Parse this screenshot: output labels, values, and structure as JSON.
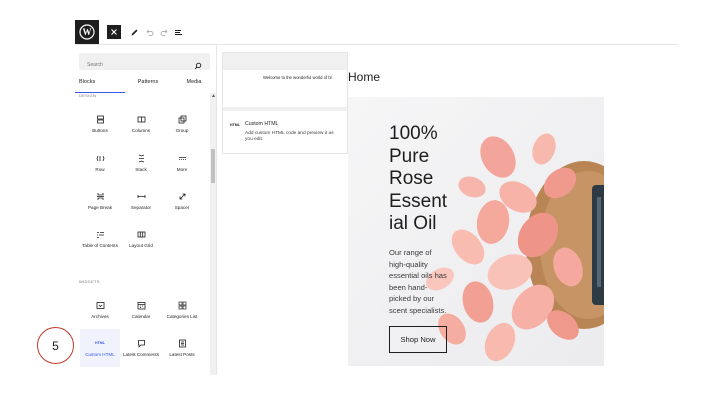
{
  "toolbar": {
    "logo_icon": "wordpress-icon",
    "close_icon": "close-icon",
    "tools_icon": "pencil-icon",
    "undo_icon": "undo-icon",
    "redo_icon": "redo-icon",
    "outline_icon": "list-view-icon"
  },
  "inserter": {
    "search_placeholder": "Search",
    "tabs": [
      "Blocks",
      "Patterns",
      "Media"
    ],
    "active_tab": "Blocks",
    "sections": {
      "design": "DESIGN",
      "widgets": "WIDGETS"
    },
    "design_blocks": [
      {
        "label": "Buttons",
        "icon": "buttons-icon"
      },
      {
        "label": "Columns",
        "icon": "columns-icon"
      },
      {
        "label": "Group",
        "icon": "group-icon"
      },
      {
        "label": "Row",
        "icon": "row-icon"
      },
      {
        "label": "Stack",
        "icon": "stack-icon"
      },
      {
        "label": "More",
        "icon": "more-icon"
      },
      {
        "label": "Page Break",
        "icon": "page-break-icon"
      },
      {
        "label": "Separator",
        "icon": "separator-icon"
      },
      {
        "label": "Spacer",
        "icon": "spacer-icon"
      },
      {
        "label": "Table of Contents",
        "icon": "table-of-contents-icon"
      },
      {
        "label": "Layout Grid",
        "icon": "layout-grid-icon"
      }
    ],
    "widget_blocks": [
      {
        "label": "Archives",
        "icon": "archives-icon"
      },
      {
        "label": "Calendar",
        "icon": "calendar-icon"
      },
      {
        "label": "Categories List",
        "icon": "categories-icon"
      },
      {
        "label": "Custom HTML",
        "icon": "html-icon",
        "badge": "HTML"
      },
      {
        "label": "Latest Comments",
        "icon": "comments-icon"
      },
      {
        "label": "Latest Posts",
        "icon": "latest-posts-icon"
      }
    ]
  },
  "preview": {
    "sample_text": "Welcome to the wonderful world of bl",
    "badge": "HTML",
    "title": "Custom HTML",
    "description": "Add custom HTML code and preview it as you edit."
  },
  "canvas": {
    "page_title": "Home",
    "hero_heading": "100% Pure Rose Essent ial Oil",
    "hero_heading_lines": [
      "100%",
      "Pure",
      "Rose",
      "Essent",
      "ial Oil"
    ],
    "hero_paragraph": "Our range of high-quality essential oils has been hand-picked by our scent specialists.",
    "hero_paragraph_lines": [
      "Our range of",
      "high-quality",
      "essential oils has",
      "been hand-",
      "picked by our",
      "scent specialists."
    ],
    "button_label": "Shop Now"
  },
  "annotation": {
    "step_number": "5"
  }
}
